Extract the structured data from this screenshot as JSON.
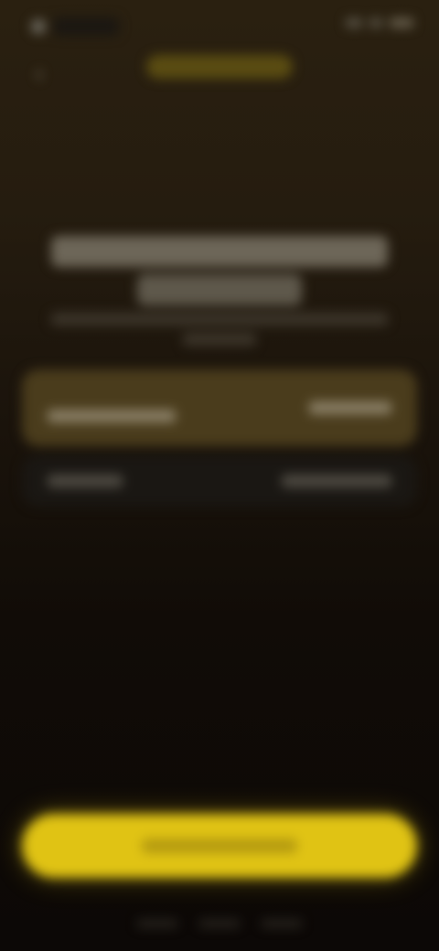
{
  "screen": {
    "title": "",
    "colors": {
      "background_top": "#2a2010",
      "background_bottom": "#0c0806",
      "accent": "#e0c314",
      "selected_option": "#4a3c1c",
      "option": "#1a1713"
    }
  },
  "status_bar": {
    "icons": [
      "app-glyph-icon",
      "signal-icon",
      "wifi-icon",
      "battery-icon"
    ]
  },
  "header": {
    "back_icon": "chevron-left-icon",
    "pill_label": ""
  },
  "headline": {
    "text": ""
  },
  "subtitle": {
    "text": ""
  },
  "options": [
    {
      "label": "",
      "price": "",
      "selected": true
    },
    {
      "label": "",
      "price": "",
      "selected": false
    }
  ],
  "cta": {
    "label": ""
  },
  "footer": {
    "links": [
      "",
      "",
      ""
    ]
  }
}
